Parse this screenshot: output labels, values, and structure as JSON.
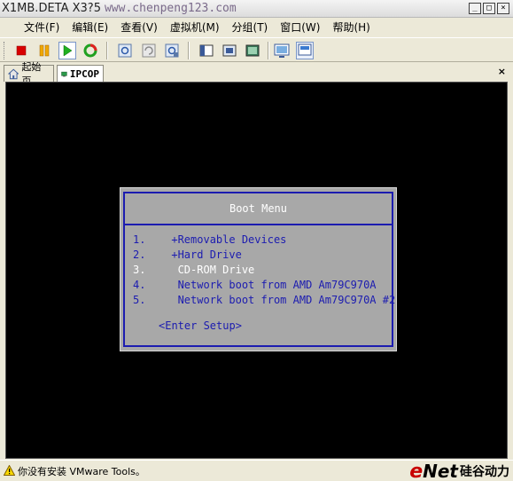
{
  "window": {
    "title_app": "X1MB.DETA X3?5",
    "title_watermark": "www.chenpeng123.com",
    "min_glyph": "_",
    "max_glyph": "□",
    "close_glyph": "×"
  },
  "menu": {
    "items": [
      "文件(F)",
      "编辑(E)",
      "查看(V)",
      "虚拟机(M)",
      "分组(T)",
      "窗口(W)",
      "帮助(H)"
    ]
  },
  "toolbar": {
    "buttons": [
      "power-off",
      "pause",
      "power-on",
      "reset",
      "snapshot",
      "revert-snapshot",
      "snapshot-manager",
      "quick-switch",
      "summary-view",
      "console-view",
      "full-screen",
      "unity"
    ]
  },
  "tabs": {
    "items": [
      {
        "label": "起始页",
        "icon": "home-icon"
      },
      {
        "label": "IPCOP",
        "icon": "vm-icon",
        "active": true
      }
    ],
    "close_glyph": "×"
  },
  "boot_menu": {
    "title": "Boot Menu",
    "items": [
      "1.    +Removable Devices",
      "2.    +Hard Drive",
      "3.     CD-ROM Drive",
      "4.     Network boot from AMD Am79C970A",
      "5.     Network boot from AMD Am79C970A #2"
    ],
    "selected_index": 2,
    "setup": "<Enter Setup>",
    "colors": {
      "background": "#a8a8a8",
      "text": "#1c1cb0",
      "selected": "#ffffff"
    }
  },
  "status": {
    "message": "你没有安装 VMware Tools。",
    "watermark_e": "e",
    "watermark_net": "Net",
    "watermark_cn": "硅谷动力"
  }
}
